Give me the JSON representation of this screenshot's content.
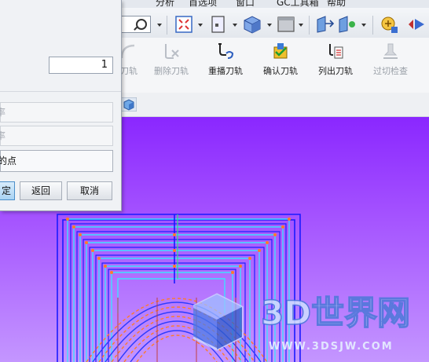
{
  "menubar": {
    "items": [
      "分析",
      "首选项",
      "窗口",
      "GC工具箱",
      "帮助"
    ]
  },
  "toolbar": {
    "tools": [
      {
        "label": "刀轨",
        "enabled": false
      },
      {
        "label": "删除刀轨",
        "enabled": false
      },
      {
        "label": "重播刀轨",
        "enabled": true
      },
      {
        "label": "确认刀轨",
        "enabled": true
      },
      {
        "label": "列出刀轨",
        "enabled": true
      },
      {
        "label": "过切检查",
        "enabled": false
      }
    ]
  },
  "dialog": {
    "number_value": "1",
    "disabled_field_1": "率",
    "disabled_field_2": "率",
    "enabled_field": "的点",
    "ok_label": "定",
    "back_label": "返回",
    "cancel_label": "取消"
  },
  "watermark": {
    "title": "3D世界网",
    "url": "WWW.3DSJW.COM"
  },
  "colors": {
    "viewport_top": "#8a27ff",
    "viewport_bottom": "#c496ff",
    "path_cyan": "#3fe0ff",
    "path_blue": "#1a1aff",
    "point_orange": "#ff7a2a"
  }
}
